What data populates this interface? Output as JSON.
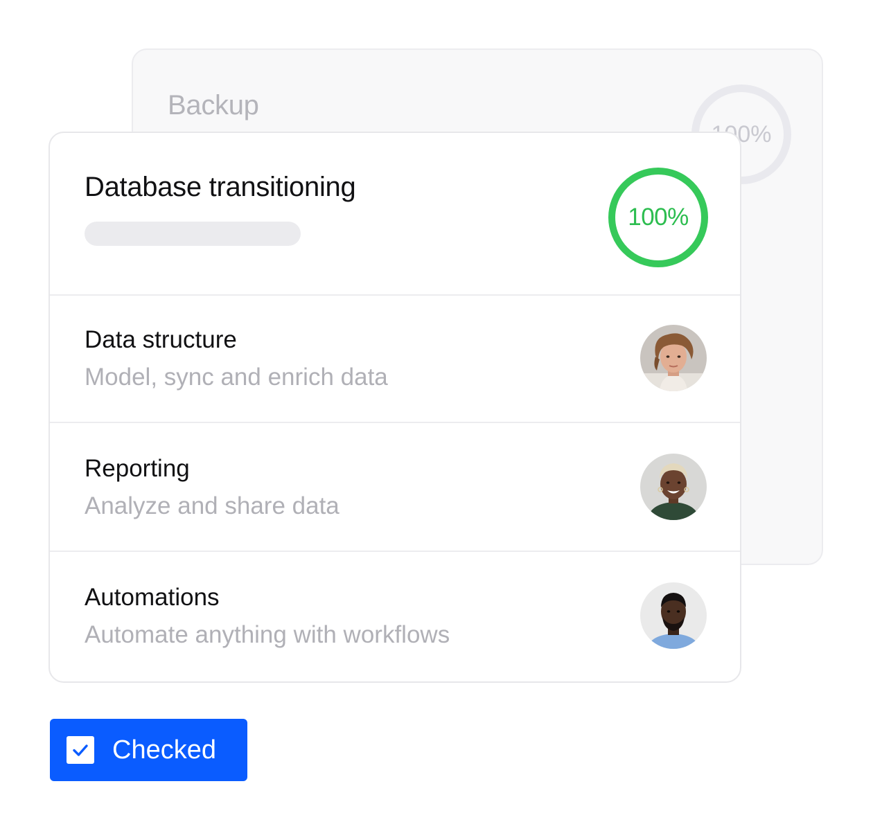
{
  "back_card": {
    "title": "Backup",
    "progress_label": "100%",
    "progress_value": 100
  },
  "front_card": {
    "title": "Database transitioning",
    "progress_label": "100%",
    "progress_value": 100,
    "ring_color": "#36c95a",
    "items": [
      {
        "title": "Data structure",
        "subtitle": "Model, sync and enrich data",
        "avatar": "avatar-young-man-curly-hair"
      },
      {
        "title": "Reporting",
        "subtitle": "Analyze and share data",
        "avatar": "avatar-smiling-woman-short-blonde-hair"
      },
      {
        "title": "Automations",
        "subtitle": "Automate anything with workflows",
        "avatar": "avatar-man-beard-blue-shirt"
      }
    ]
  },
  "checked_button": {
    "label": "Checked",
    "checked": true,
    "color": "#0a5cff",
    "icon": "checkmark-icon"
  }
}
